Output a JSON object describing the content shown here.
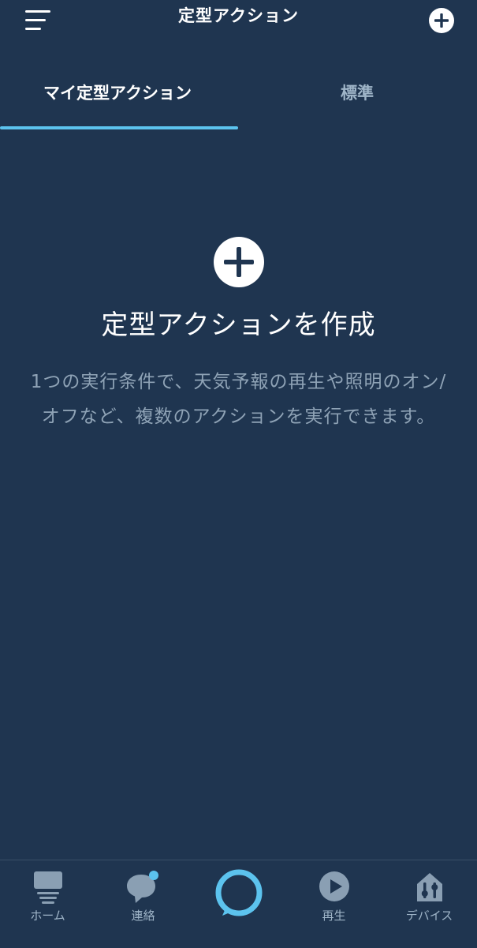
{
  "header": {
    "title": "定型アクション",
    "menu_icon": "menu-icon",
    "add_icon": "plus-circle-icon"
  },
  "tabs": [
    {
      "label": "マイ定型アクション",
      "active": true
    },
    {
      "label": "標準",
      "active": false
    }
  ],
  "empty_state": {
    "icon": "plus-circle-icon",
    "title": "定型アクションを作成",
    "description": "1つの実行条件で、天気予報の再生や照明のオン/オフなど、複数のアクションを実行できます。"
  },
  "bottom_nav": {
    "items": [
      {
        "label": "ホーム",
        "icon": "home-icon"
      },
      {
        "label": "連絡",
        "icon": "chat-bubble-icon"
      },
      {
        "label": "",
        "icon": "alexa-ring-icon"
      },
      {
        "label": "再生",
        "icon": "play-circle-icon"
      },
      {
        "label": "デバイス",
        "icon": "devices-house-icon"
      }
    ]
  },
  "colors": {
    "background": "#1f3550",
    "accent": "#5cc3ee",
    "text_primary": "#ffffff",
    "text_secondary": "#8fa3b6",
    "nav_icon": "#8a9fb3"
  }
}
